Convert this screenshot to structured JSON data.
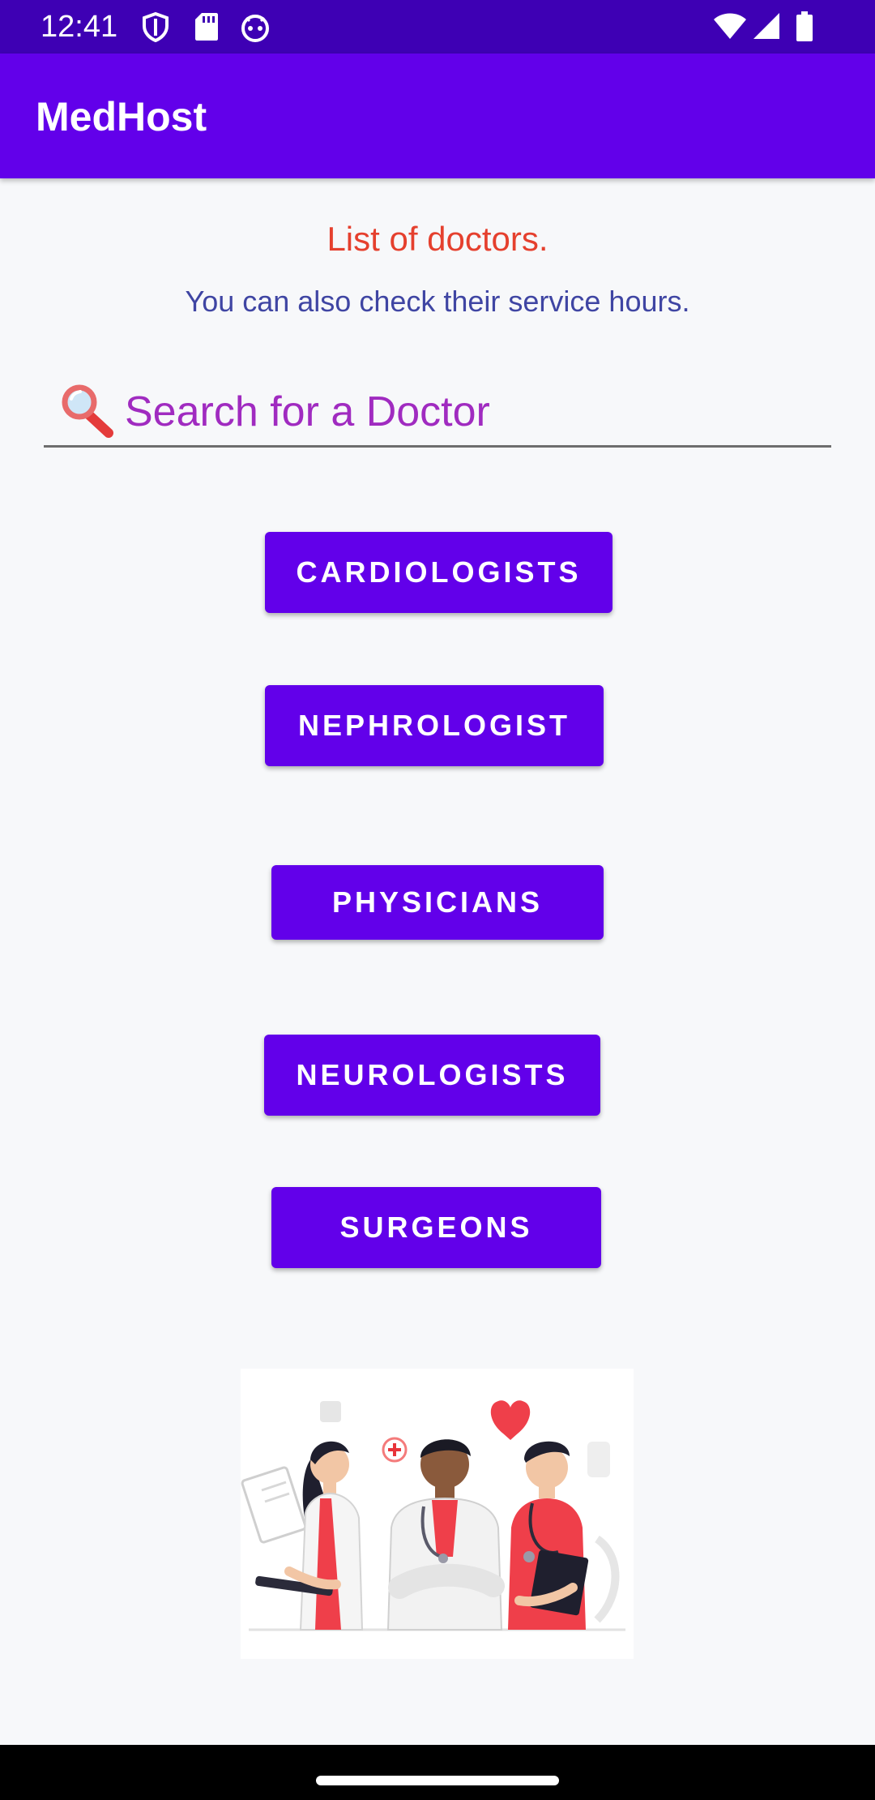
{
  "status_bar": {
    "time": "12:41",
    "left_icons": [
      "shield-icon",
      "sd-card-icon",
      "android-face-icon"
    ],
    "right_icons": [
      "wifi-icon",
      "cellular-signal-icon",
      "battery-icon"
    ]
  },
  "app_bar": {
    "title": "MedHost"
  },
  "main": {
    "heading": "List of doctors.",
    "subheading": "You can also check their service hours.",
    "search": {
      "icon": "search-icon",
      "text": "Search for a Doctor"
    },
    "buttons": [
      {
        "label": "CARDIOLOGISTS"
      },
      {
        "label": "NEPHROLOGIST"
      },
      {
        "label": "PHYSICIANS"
      },
      {
        "label": "NEUROLOGISTS"
      },
      {
        "label": "SURGEONS"
      }
    ],
    "illustration": "doctors-illustration"
  },
  "colors": {
    "primary": "#6200ea",
    "status_bar": "#3e00b4",
    "heading": "#e5402e",
    "subheading": "#3f45a3",
    "search_text": "#a02bc0",
    "background": "#f7f8fa"
  }
}
